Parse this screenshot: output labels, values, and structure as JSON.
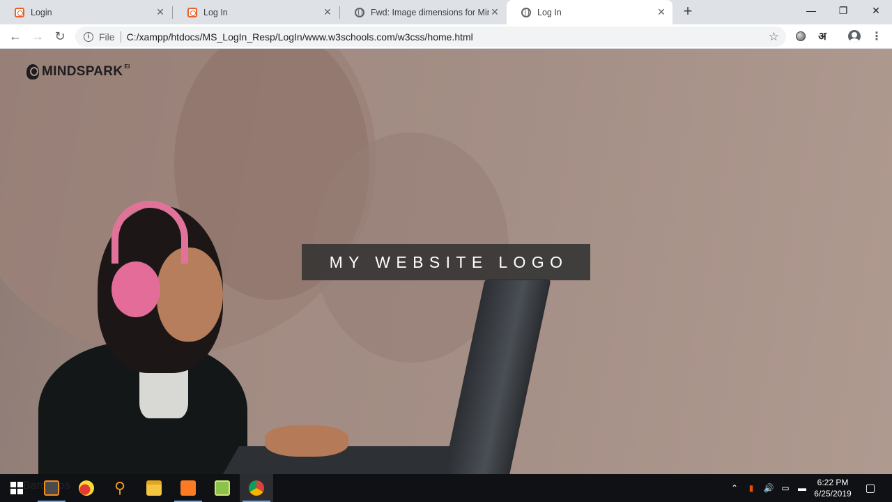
{
  "browser": {
    "tabs": [
      {
        "title": "Login",
        "favicon": "xampp-icon",
        "active": false
      },
      {
        "title": "Log In",
        "favicon": "xampp-icon",
        "active": false
      },
      {
        "title": "Fwd: Image dimensions for Mind",
        "favicon": "globe-icon",
        "active": false
      },
      {
        "title": "Log In",
        "favicon": "globe-icon",
        "active": true
      }
    ],
    "new_tab_label": "+",
    "window_controls": {
      "minimize": "—",
      "maximize": "❐",
      "close": "✕"
    },
    "toolbar": {
      "back": "←",
      "forward": "→",
      "reload": "↻",
      "scheme": "File",
      "url": "C:/xampp/htdocs/MS_LogIn_Resp/LogIn/www.w3schools.com/w3css/home.html",
      "bookmark": "☆",
      "lang_ext": "अ",
      "menu": "⋮"
    }
  },
  "page": {
    "brand": {
      "name": "MINDSPARK",
      "superscript": "EI"
    },
    "hero_text": "MY WEBSITE LOGO"
  },
  "taskbar": {
    "time": "6:22 PM",
    "date": "6/25/2019",
    "ghost_text": "Barcapps"
  },
  "colors": {
    "tab_strip": "#dee1e6",
    "logo_box": "#323232",
    "taskbar": "#101114"
  }
}
